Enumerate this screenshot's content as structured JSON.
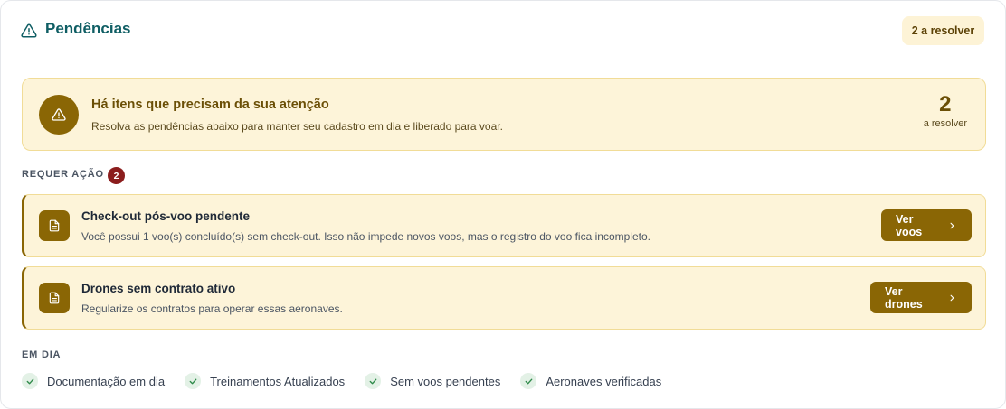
{
  "header": {
    "title": "Pendências",
    "pending_pill": "2 a resolver"
  },
  "banner": {
    "title": "Há itens que precisam da sua atenção",
    "subtitle": "Resolva as pendências abaixo para manter seu cadastro em dia e liberado para voar.",
    "count": "2",
    "count_label": "a resolver"
  },
  "requires_action": {
    "label": "REQUER AÇÃO",
    "count": "2",
    "items": [
      {
        "title": "Check-out pós-voo pendente",
        "description": "Você possui 1 voo(s) concluído(s) sem check-out. Isso não impede novos voos, mas o registro do voo fica incompleto.",
        "button": "Ver voos"
      },
      {
        "title": "Drones sem contrato ativo",
        "description": "Regularize os contratos para operar essas aeronaves.",
        "button": "Ver drones"
      }
    ]
  },
  "up_to_date": {
    "label": "EM DIA",
    "items": [
      "Documentação em dia",
      "Treinamentos Atualizados",
      "Sem voos pendentes",
      "Aeronaves verificadas"
    ]
  },
  "colors": {
    "accent": "#8a6605",
    "title_teal": "#0f5e64",
    "badge_red": "#8b1d1d",
    "banner_bg": "#fdf4d9"
  },
  "icons": {
    "header": "warning-triangle-icon",
    "task": "document-icon",
    "button": "chevron-right-icon",
    "ok": "check-icon"
  }
}
